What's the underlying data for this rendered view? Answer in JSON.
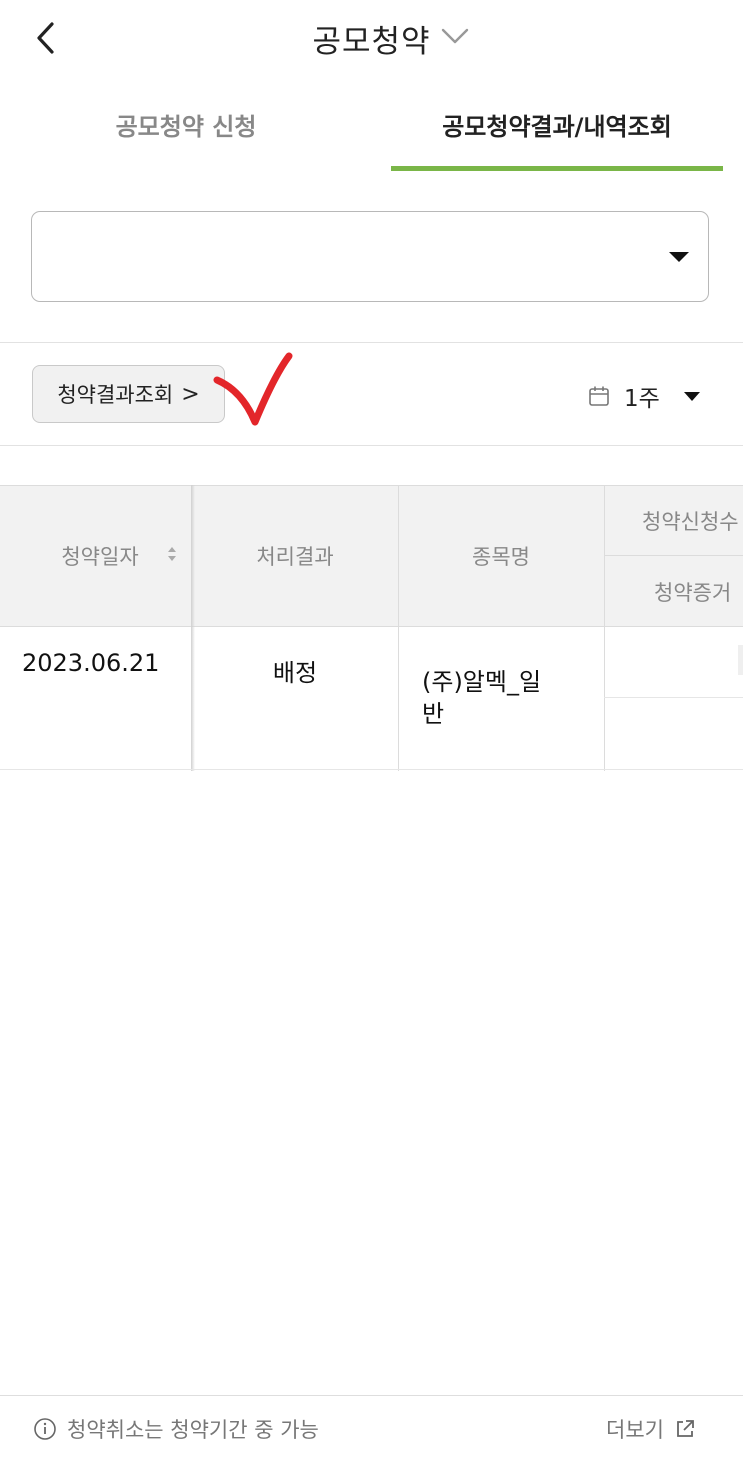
{
  "header": {
    "title": "공모청약",
    "back_icon": "chevron-left-icon",
    "title_dropdown_icon": "chevron-down-icon"
  },
  "tabs": [
    {
      "label": "공모청약 신청",
      "active": false
    },
    {
      "label": "공모청약결과/내역조회",
      "active": true
    }
  ],
  "active_tab_color": "#7ab648",
  "account_select": {
    "value": "",
    "caret_icon": "caret-down-icon"
  },
  "toolbar": {
    "result_button_label": "청약결과조회",
    "result_button_chevron": ">",
    "period_label": "1주",
    "calendar_icon": "calendar-icon",
    "annotation_color": "#e3262a"
  },
  "table": {
    "headers": {
      "date": "청약일자",
      "result": "처리결과",
      "name": "종목명",
      "qty_top": "청약신청수",
      "qty_bottom": "청약증거"
    },
    "rows": [
      {
        "date": "2023.06.21",
        "result": "배정",
        "name": "(주)알멕_일반",
        "name_line1": "(주)알멕_일",
        "name_line2": "반"
      }
    ]
  },
  "footer": {
    "info_text": "청약취소는 청약기간 중 가능",
    "more_label": "더보기",
    "info_icon": "info-icon",
    "external_icon": "external-link-icon"
  }
}
